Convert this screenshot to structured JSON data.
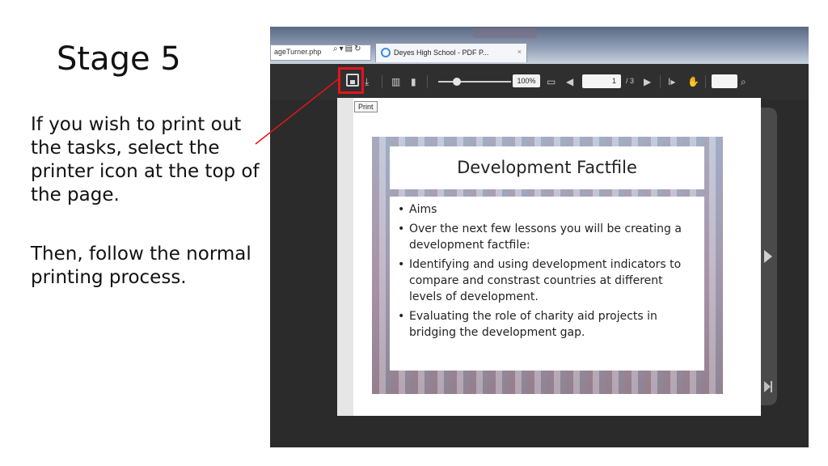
{
  "left_panel": {
    "title": "Stage 5",
    "instruction_1": "If you wish to print out the tasks, select the printer icon at the top of the page.",
    "instruction_2": "Then, follow the normal printing process."
  },
  "browser": {
    "address_text": "ageTurner.php",
    "tab_title": "Deyes High School - PDF P...",
    "tab_close": "×"
  },
  "pdf_toolbar": {
    "zoom": "100%",
    "page_current": "1",
    "page_total": "/ 3",
    "print_tooltip": "Print",
    "highlight_color": "#e3141b"
  },
  "slide": {
    "title": "Development Factfile",
    "bullets": [
      "Aims",
      "Over the next few lessons you will be creating a development factfile:",
      "Identifying and using development indicators to compare and constrast countries at different levels of development.",
      "Evaluating the role of charity aid projects in bridging the development gap."
    ]
  },
  "icons": [
    "print-icon",
    "download-icon",
    "pages-icon",
    "page-icon",
    "monitor-icon",
    "prev-page-icon",
    "next-page-icon",
    "text-select-icon",
    "hand-icon",
    "search-icon",
    "next-arrow-icon",
    "last-page-icon"
  ]
}
